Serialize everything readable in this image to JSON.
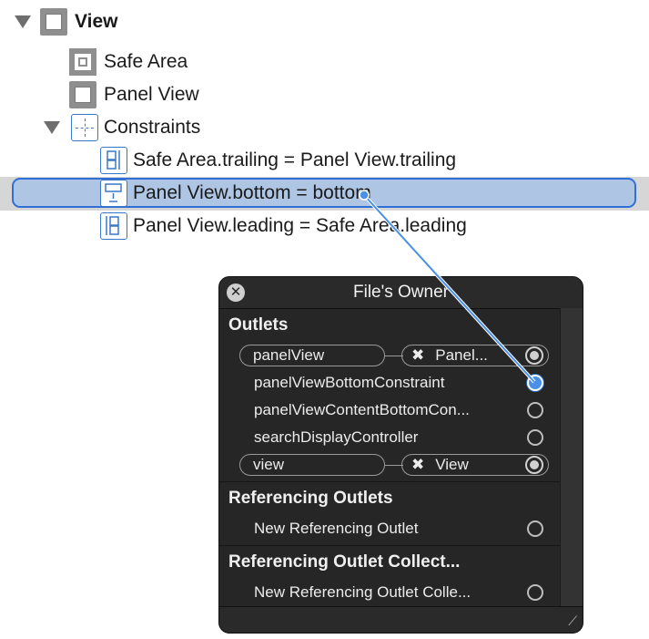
{
  "tree": {
    "view_label": "View",
    "safe_area_label": "Safe Area",
    "panel_view_label": "Panel View",
    "constraints_label": "Constraints",
    "constraint_1": "Safe Area.trailing = Panel View.trailing",
    "constraint_2": "Panel View.bottom = bottom",
    "constraint_3": "Panel View.leading = Safe Area.leading"
  },
  "hud": {
    "title": "File's Owner",
    "close_glyph": "✕",
    "outlets_header": "Outlets",
    "outlets": [
      {
        "name": "panelView",
        "target": "Panel..."
      },
      {
        "name": "panelViewBottomConstraint"
      },
      {
        "name": "panelViewContentBottomCon..."
      },
      {
        "name": "searchDisplayController"
      },
      {
        "name": "view",
        "target": "View"
      }
    ],
    "ref_outlets_header": "Referencing Outlets",
    "ref_outlets_item": "New Referencing Outlet",
    "ref_collections_header": "Referencing Outlet Collect...",
    "ref_collections_item": "New Referencing Outlet Colle...",
    "remove_glyph": "✖",
    "grip_glyph": "⟋"
  },
  "colors": {
    "selection_border": "#2f6fd6",
    "selection_fill": "#aec5e4",
    "connection_line": "#4a90e8",
    "hud_background": "#262626"
  },
  "icons": {
    "view": "view-icon",
    "safe_area": "safe-area-icon",
    "constraints": "constraints-icon",
    "constraint": "constraint-icon",
    "disclosure": "disclosure-triangle-icon",
    "close": "close-icon",
    "resize": "resize-grip-icon"
  }
}
